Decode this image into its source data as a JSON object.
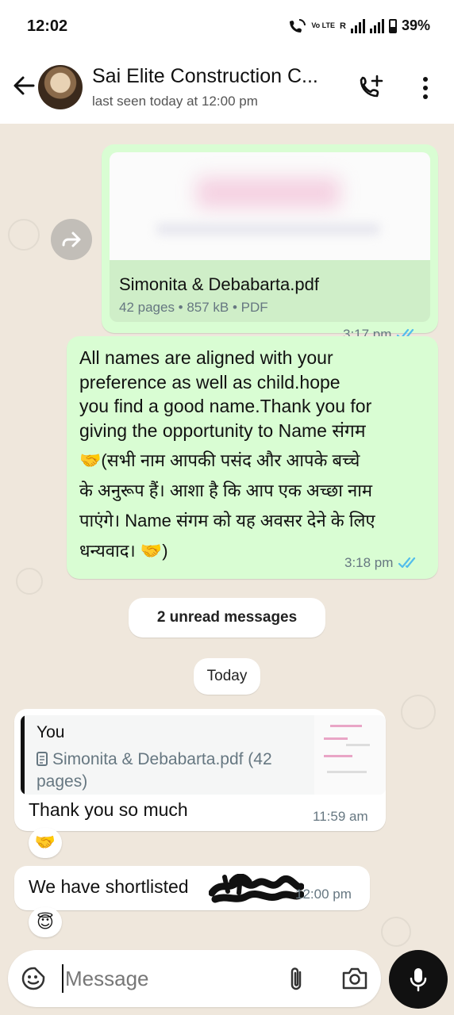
{
  "status_bar": {
    "time": "12:02",
    "network_label": "Vo LTE",
    "roaming": "R",
    "battery": "39%"
  },
  "header": {
    "contact_name": "Sai Elite Construction C...",
    "last_seen": "last seen today at 12:00 pm"
  },
  "messages": {
    "pdf": {
      "file_name": "Simonita & Debabarta.pdf",
      "details": "42 pages • 857 kB • PDF",
      "time": "3:17 pm"
    },
    "text_message": {
      "english_lines": [
        "All names are aligned with your",
        "preference as well as child.hope",
        "you find a good name.Thank you for",
        "giving the opportunity to Name संगम"
      ],
      "hindi_lines": [
        "🤝(सभी नाम आपकी पसंद और आपके बच्चे",
        "के अनुरूप हैं। आशा है कि आप एक अच्छा नाम",
        "पाएंगे। Name संगम को यह अवसर देने के लिए",
        "धन्यवाद। 🤝)"
      ],
      "time": "3:18 pm"
    },
    "unread_label": "2 unread messages",
    "date_label": "Today",
    "reply": {
      "quoted_sender": "You",
      "quoted_doc": "Simonita & Debabarta.pdf (42 pages)",
      "text": "Thank you so much",
      "time": "11:59 am",
      "reaction": "🤝"
    },
    "shortlist": {
      "text": "We have shortlisted",
      "time": "12:00 pm",
      "reaction": "😇"
    }
  },
  "input": {
    "placeholder": "Message"
  },
  "colors": {
    "outgoing_bubble": "#d9fdd3",
    "incoming_bubble": "#ffffff",
    "read_ticks": "#53bdeb",
    "chat_background": "#efe7dc"
  },
  "icons": [
    "back-arrow-icon",
    "add-call-icon",
    "more-vert-icon",
    "forward-icon",
    "double-check-icon",
    "sticker-icon",
    "attach-icon",
    "camera-icon",
    "mic-icon"
  ]
}
